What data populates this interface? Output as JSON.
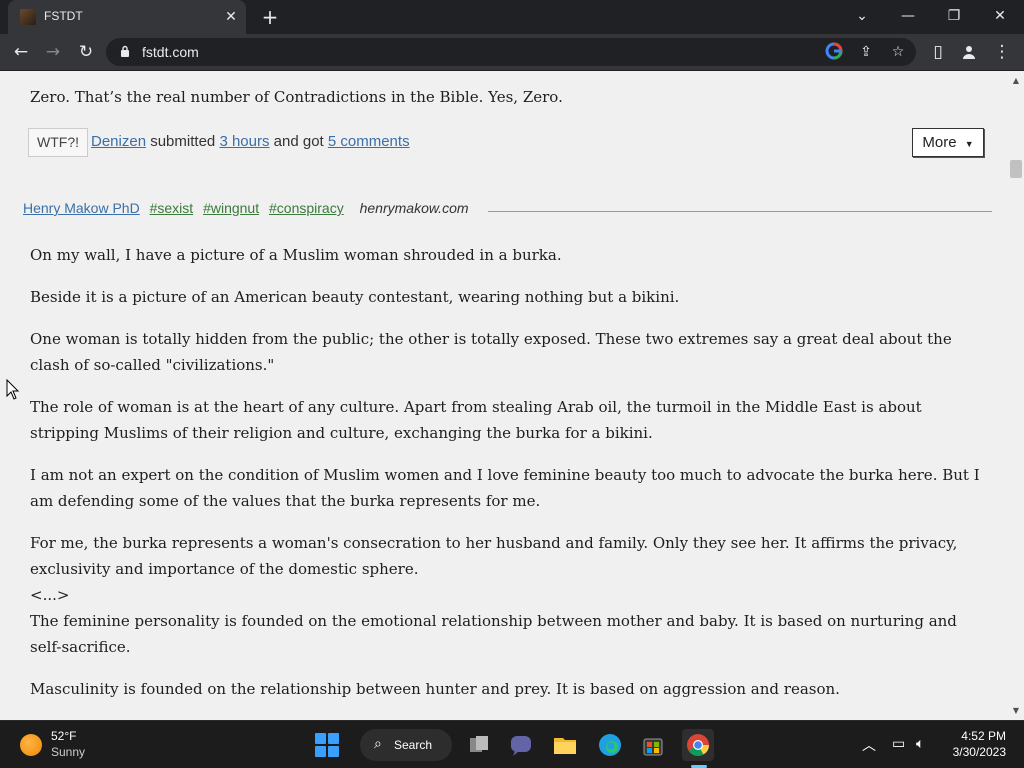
{
  "browser": {
    "tab_title": "FSTDT",
    "url": "fstdt.com"
  },
  "post_prev": {
    "quote": "Zero. That’s the real number of Contradictions in the Bible. Yes, Zero.",
    "wtf_label": "WTF?!",
    "submitter": "Denizen",
    "submitted_word": "submitted",
    "time_ago": "3 hours",
    "and_got": "and got",
    "comments": "5 comments",
    "more_label": "More"
  },
  "post": {
    "author": "Henry Makow PhD",
    "tags": [
      "#sexist",
      "#wingnut",
      "#conspiracy"
    ],
    "site": "henrymakow.com",
    "paragraphs": [
      "On my wall, I have a picture of a Muslim woman shrouded in a burka.",
      "Beside it is a picture of an American beauty contestant, wearing nothing but a bikini.",
      "One woman is totally hidden from the public; the other is totally exposed. These two extremes say a great deal about the clash of so-called \"civilizations.\"",
      "The role of woman is at the heart of any culture. Apart from stealing Arab oil, the turmoil in the Middle East is about stripping Muslims of their religion and culture, exchanging the burka for a bikini.",
      "I am not an expert on the condition of Muslim women and I love feminine beauty too much to advocate the burka here. But I am defending some of the values that the burka represents for me.",
      "For me, the burka represents a woman's consecration to her husband and family. Only they see her. It affirms the privacy, exclusivity and importance of the domestic sphere.",
      "<...>",
      "The feminine personality is founded on the emotional relationship between mother and baby. It is based on nurturing and self-sacrifice.",
      "Masculinity is founded on the relationship between hunter and prey. It is based on aggression and reason."
    ]
  },
  "taskbar": {
    "weather_temp": "52°F",
    "weather_cond": "Sunny",
    "search_label": "Search",
    "time": "4:52 PM",
    "date": "3/30/2023"
  }
}
